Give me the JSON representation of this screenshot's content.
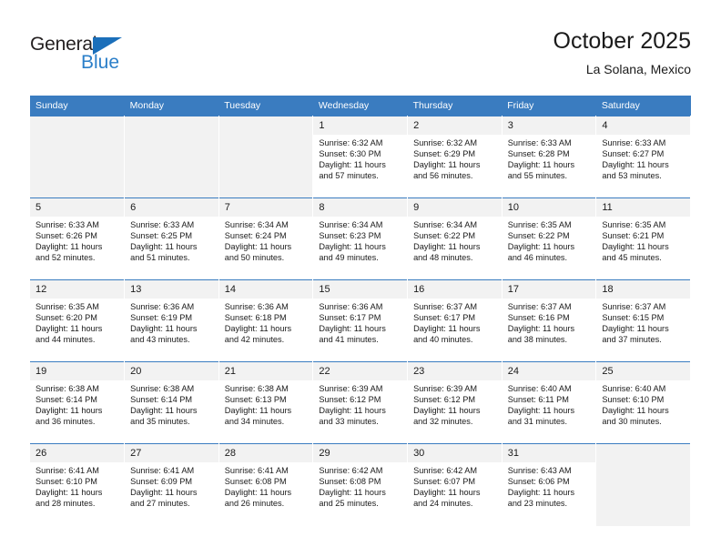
{
  "logo": {
    "word1": "General",
    "word2": "Blue",
    "triangle_color": "#1b6fba",
    "word2_color": "#2b7fc9"
  },
  "header": {
    "title": "October 2025",
    "subtitle": "La Solana, Mexico"
  },
  "theme": {
    "header_blue": "#3a7cc0",
    "daynum_band": "#f2f2f2",
    "empty_cell": "#f2f2f2",
    "text": "#1a1a1a"
  },
  "weekdays": [
    "Sunday",
    "Monday",
    "Tuesday",
    "Wednesday",
    "Thursday",
    "Friday",
    "Saturday"
  ],
  "labels": {
    "sunrise_prefix": "Sunrise:",
    "sunset_prefix": "Sunset:",
    "daylight_prefix": "Daylight:"
  },
  "weeks": [
    [
      {
        "empty": true
      },
      {
        "empty": true
      },
      {
        "empty": true
      },
      {
        "day": "1",
        "sunrise": "Sunrise: 6:32 AM",
        "sunset": "Sunset: 6:30 PM",
        "daylight_l1": "Daylight: 11 hours",
        "daylight_l2": "and 57 minutes."
      },
      {
        "day": "2",
        "sunrise": "Sunrise: 6:32 AM",
        "sunset": "Sunset: 6:29 PM",
        "daylight_l1": "Daylight: 11 hours",
        "daylight_l2": "and 56 minutes."
      },
      {
        "day": "3",
        "sunrise": "Sunrise: 6:33 AM",
        "sunset": "Sunset: 6:28 PM",
        "daylight_l1": "Daylight: 11 hours",
        "daylight_l2": "and 55 minutes."
      },
      {
        "day": "4",
        "sunrise": "Sunrise: 6:33 AM",
        "sunset": "Sunset: 6:27 PM",
        "daylight_l1": "Daylight: 11 hours",
        "daylight_l2": "and 53 minutes."
      }
    ],
    [
      {
        "day": "5",
        "sunrise": "Sunrise: 6:33 AM",
        "sunset": "Sunset: 6:26 PM",
        "daylight_l1": "Daylight: 11 hours",
        "daylight_l2": "and 52 minutes."
      },
      {
        "day": "6",
        "sunrise": "Sunrise: 6:33 AM",
        "sunset": "Sunset: 6:25 PM",
        "daylight_l1": "Daylight: 11 hours",
        "daylight_l2": "and 51 minutes."
      },
      {
        "day": "7",
        "sunrise": "Sunrise: 6:34 AM",
        "sunset": "Sunset: 6:24 PM",
        "daylight_l1": "Daylight: 11 hours",
        "daylight_l2": "and 50 minutes."
      },
      {
        "day": "8",
        "sunrise": "Sunrise: 6:34 AM",
        "sunset": "Sunset: 6:23 PM",
        "daylight_l1": "Daylight: 11 hours",
        "daylight_l2": "and 49 minutes."
      },
      {
        "day": "9",
        "sunrise": "Sunrise: 6:34 AM",
        "sunset": "Sunset: 6:22 PM",
        "daylight_l1": "Daylight: 11 hours",
        "daylight_l2": "and 48 minutes."
      },
      {
        "day": "10",
        "sunrise": "Sunrise: 6:35 AM",
        "sunset": "Sunset: 6:22 PM",
        "daylight_l1": "Daylight: 11 hours",
        "daylight_l2": "and 46 minutes."
      },
      {
        "day": "11",
        "sunrise": "Sunrise: 6:35 AM",
        "sunset": "Sunset: 6:21 PM",
        "daylight_l1": "Daylight: 11 hours",
        "daylight_l2": "and 45 minutes."
      }
    ],
    [
      {
        "day": "12",
        "sunrise": "Sunrise: 6:35 AM",
        "sunset": "Sunset: 6:20 PM",
        "daylight_l1": "Daylight: 11 hours",
        "daylight_l2": "and 44 minutes."
      },
      {
        "day": "13",
        "sunrise": "Sunrise: 6:36 AM",
        "sunset": "Sunset: 6:19 PM",
        "daylight_l1": "Daylight: 11 hours",
        "daylight_l2": "and 43 minutes."
      },
      {
        "day": "14",
        "sunrise": "Sunrise: 6:36 AM",
        "sunset": "Sunset: 6:18 PM",
        "daylight_l1": "Daylight: 11 hours",
        "daylight_l2": "and 42 minutes."
      },
      {
        "day": "15",
        "sunrise": "Sunrise: 6:36 AM",
        "sunset": "Sunset: 6:17 PM",
        "daylight_l1": "Daylight: 11 hours",
        "daylight_l2": "and 41 minutes."
      },
      {
        "day": "16",
        "sunrise": "Sunrise: 6:37 AM",
        "sunset": "Sunset: 6:17 PM",
        "daylight_l1": "Daylight: 11 hours",
        "daylight_l2": "and 40 minutes."
      },
      {
        "day": "17",
        "sunrise": "Sunrise: 6:37 AM",
        "sunset": "Sunset: 6:16 PM",
        "daylight_l1": "Daylight: 11 hours",
        "daylight_l2": "and 38 minutes."
      },
      {
        "day": "18",
        "sunrise": "Sunrise: 6:37 AM",
        "sunset": "Sunset: 6:15 PM",
        "daylight_l1": "Daylight: 11 hours",
        "daylight_l2": "and 37 minutes."
      }
    ],
    [
      {
        "day": "19",
        "sunrise": "Sunrise: 6:38 AM",
        "sunset": "Sunset: 6:14 PM",
        "daylight_l1": "Daylight: 11 hours",
        "daylight_l2": "and 36 minutes."
      },
      {
        "day": "20",
        "sunrise": "Sunrise: 6:38 AM",
        "sunset": "Sunset: 6:14 PM",
        "daylight_l1": "Daylight: 11 hours",
        "daylight_l2": "and 35 minutes."
      },
      {
        "day": "21",
        "sunrise": "Sunrise: 6:38 AM",
        "sunset": "Sunset: 6:13 PM",
        "daylight_l1": "Daylight: 11 hours",
        "daylight_l2": "and 34 minutes."
      },
      {
        "day": "22",
        "sunrise": "Sunrise: 6:39 AM",
        "sunset": "Sunset: 6:12 PM",
        "daylight_l1": "Daylight: 11 hours",
        "daylight_l2": "and 33 minutes."
      },
      {
        "day": "23",
        "sunrise": "Sunrise: 6:39 AM",
        "sunset": "Sunset: 6:12 PM",
        "daylight_l1": "Daylight: 11 hours",
        "daylight_l2": "and 32 minutes."
      },
      {
        "day": "24",
        "sunrise": "Sunrise: 6:40 AM",
        "sunset": "Sunset: 6:11 PM",
        "daylight_l1": "Daylight: 11 hours",
        "daylight_l2": "and 31 minutes."
      },
      {
        "day": "25",
        "sunrise": "Sunrise: 6:40 AM",
        "sunset": "Sunset: 6:10 PM",
        "daylight_l1": "Daylight: 11 hours",
        "daylight_l2": "and 30 minutes."
      }
    ],
    [
      {
        "day": "26",
        "sunrise": "Sunrise: 6:41 AM",
        "sunset": "Sunset: 6:10 PM",
        "daylight_l1": "Daylight: 11 hours",
        "daylight_l2": "and 28 minutes."
      },
      {
        "day": "27",
        "sunrise": "Sunrise: 6:41 AM",
        "sunset": "Sunset: 6:09 PM",
        "daylight_l1": "Daylight: 11 hours",
        "daylight_l2": "and 27 minutes."
      },
      {
        "day": "28",
        "sunrise": "Sunrise: 6:41 AM",
        "sunset": "Sunset: 6:08 PM",
        "daylight_l1": "Daylight: 11 hours",
        "daylight_l2": "and 26 minutes."
      },
      {
        "day": "29",
        "sunrise": "Sunrise: 6:42 AM",
        "sunset": "Sunset: 6:08 PM",
        "daylight_l1": "Daylight: 11 hours",
        "daylight_l2": "and 25 minutes."
      },
      {
        "day": "30",
        "sunrise": "Sunrise: 6:42 AM",
        "sunset": "Sunset: 6:07 PM",
        "daylight_l1": "Daylight: 11 hours",
        "daylight_l2": "and 24 minutes."
      },
      {
        "day": "31",
        "sunrise": "Sunrise: 6:43 AM",
        "sunset": "Sunset: 6:06 PM",
        "daylight_l1": "Daylight: 11 hours",
        "daylight_l2": "and 23 minutes."
      },
      {
        "empty": true
      }
    ]
  ]
}
